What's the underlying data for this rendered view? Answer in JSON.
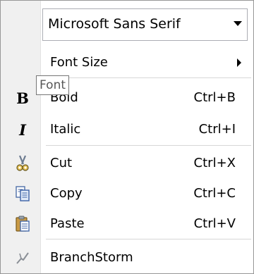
{
  "font_combo": {
    "value": "Microsoft Sans Serif",
    "icon": "chevron-down-icon"
  },
  "menu": {
    "font_size": {
      "label": "Font Size",
      "icon": "submenu-arrow-icon"
    },
    "bold": {
      "label": "Bold",
      "shortcut": "Ctrl+B",
      "icon": "bold-icon",
      "icon_text": "B"
    },
    "italic": {
      "label": "Italic",
      "shortcut": "Ctrl+I",
      "icon": "italic-icon",
      "icon_text": "I"
    },
    "cut": {
      "label": "Cut",
      "shortcut": "Ctrl+X",
      "icon": "scissors-icon"
    },
    "copy": {
      "label": "Copy",
      "shortcut": "Ctrl+C",
      "icon": "copy-icon"
    },
    "paste": {
      "label": "Paste",
      "shortcut": "Ctrl+V",
      "icon": "clipboard-icon"
    },
    "branchstorm": {
      "label": "BranchStorm",
      "icon": "branch-icon"
    }
  },
  "tooltip": {
    "text": "Font"
  },
  "colors": {
    "gutter": "#f0f0f0",
    "border": "#979797",
    "separator": "#d7d7d7"
  }
}
